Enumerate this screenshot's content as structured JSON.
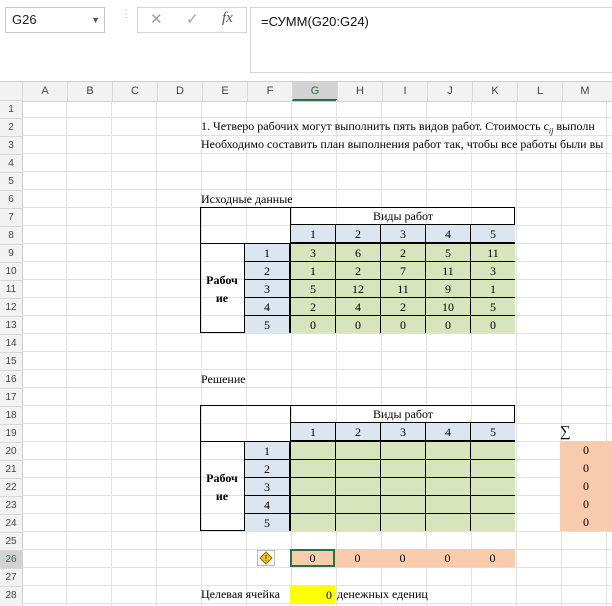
{
  "formula_bar": {
    "name_box": "G26",
    "cancel_icon": "✕",
    "enter_icon": "✓",
    "fx_icon": "fx",
    "formula": "=СУММ(G20:G24)"
  },
  "columns": [
    "A",
    "B",
    "C",
    "D",
    "E",
    "F",
    "G",
    "H",
    "I",
    "J",
    "K",
    "L",
    "M"
  ],
  "rows": [
    "1",
    "2",
    "3",
    "4",
    "5",
    "6",
    "7",
    "8",
    "9",
    "10",
    "11",
    "12",
    "13",
    "14",
    "15",
    "16",
    "17",
    "18",
    "19",
    "20",
    "21",
    "22",
    "23",
    "24",
    "25",
    "26",
    "27",
    "28"
  ],
  "text": {
    "row2": "1. Четверо рабочих могут выполнить пять видов работ. Стоимость c",
    "row2_sub": "ij",
    "row2_tail": " выполн",
    "row3": "Необходимо составить план выполнения работ так, чтобы все работы были вы",
    "row7": "Исходные данные",
    "row16": "Решение",
    "row28_label": "Целевая ячейка",
    "row28_value": "0",
    "row28_unit": "денежных едениц"
  },
  "table1": {
    "header": "Виды работ",
    "work_cols": [
      "1",
      "2",
      "3",
      "4",
      "5"
    ],
    "workers_label_1": "Рабоч",
    "workers_label_2": "ие",
    "worker_rows": [
      "1",
      "2",
      "3",
      "4",
      "5"
    ],
    "values": [
      [
        "3",
        "6",
        "2",
        "5",
        "11"
      ],
      [
        "1",
        "2",
        "7",
        "11",
        "3"
      ],
      [
        "5",
        "12",
        "11",
        "9",
        "1"
      ],
      [
        "2",
        "4",
        "2",
        "10",
        "5"
      ],
      [
        "0",
        "0",
        "0",
        "0",
        "0"
      ]
    ]
  },
  "table2": {
    "header": "Виды работ",
    "work_cols": [
      "1",
      "2",
      "3",
      "4",
      "5"
    ],
    "workers_label_1": "Рабоч",
    "workers_label_2": "ие",
    "worker_rows": [
      "1",
      "2",
      "3",
      "4",
      "5"
    ],
    "sum_symbol": "∑",
    "row_sums": [
      "0",
      "0",
      "0",
      "0",
      "0"
    ],
    "col_sums": [
      "0",
      "0",
      "0",
      "0",
      "0"
    ]
  },
  "colors": {
    "blue": "#dce6f1",
    "green": "#d8e4bc",
    "peach": "#f8cbad",
    "yellow": "#ffff00",
    "selection": "#217346"
  }
}
